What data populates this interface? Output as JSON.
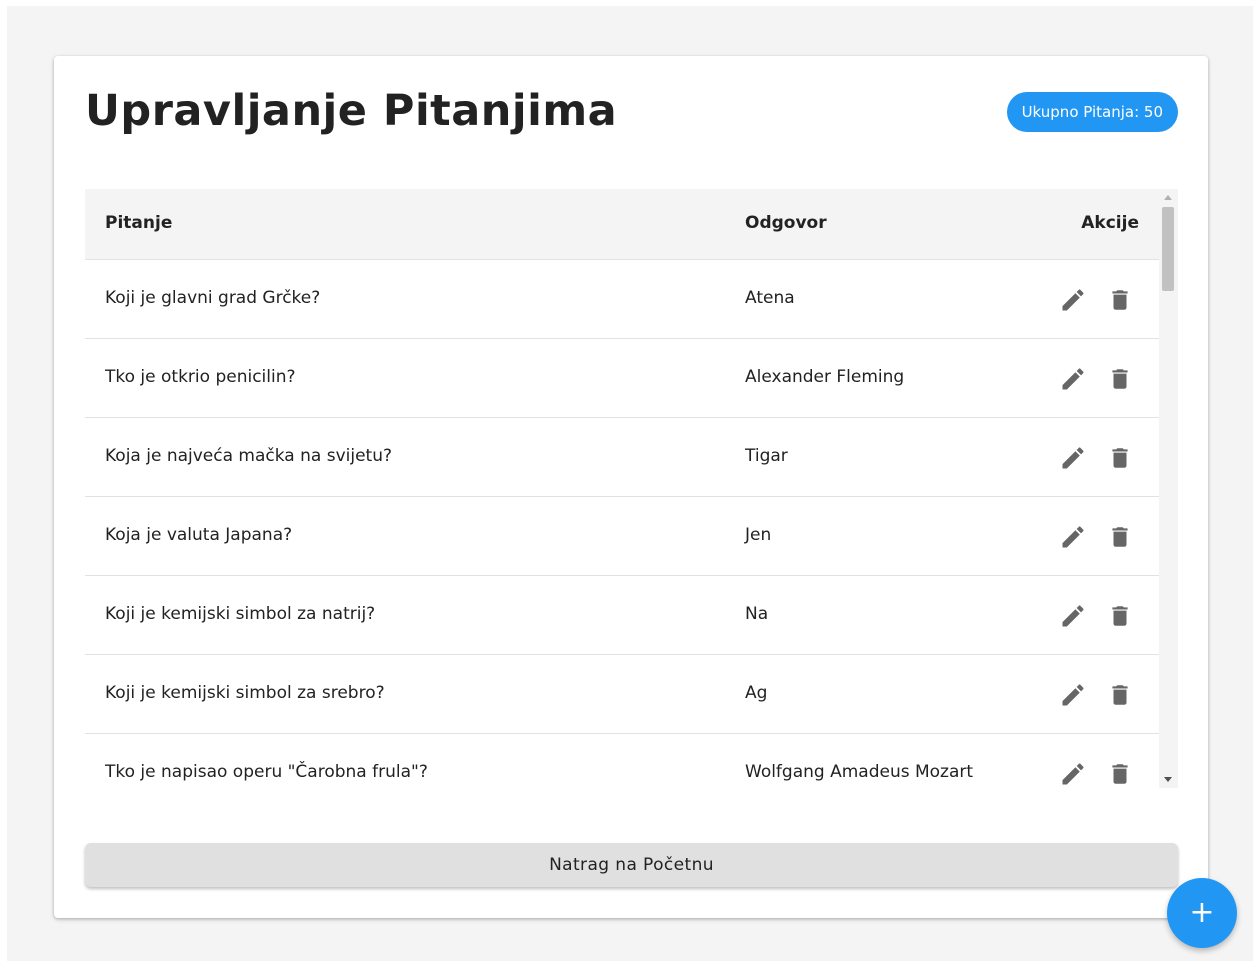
{
  "header": {
    "title": "Upravljanje Pitanjima",
    "badge": "Ukupno Pitanja: 50"
  },
  "table": {
    "columns": {
      "question": "Pitanje",
      "answer": "Odgovor",
      "actions": "Akcije"
    },
    "rows": [
      {
        "question": "Koji je glavni grad Grčke?",
        "answer": "Atena"
      },
      {
        "question": "Tko je otkrio penicilin?",
        "answer": "Alexander Fleming"
      },
      {
        "question": "Koja je najveća mačka na svijetu?",
        "answer": "Tigar"
      },
      {
        "question": "Koja je valuta Japana?",
        "answer": "Jen"
      },
      {
        "question": "Koji je kemijski simbol za natrij?",
        "answer": "Na"
      },
      {
        "question": "Koji je kemijski simbol za srebro?",
        "answer": "Ag"
      },
      {
        "question": "Tko je napisao operu \"Čarobna frula\"?",
        "answer": "Wolfgang Amadeus Mozart"
      }
    ]
  },
  "footer": {
    "back_label": "Natrag na Početnu"
  },
  "fab": {
    "label": "+"
  },
  "icons": {
    "edit": "pencil-icon",
    "delete": "trash-icon",
    "add": "plus-icon"
  },
  "colors": {
    "accent": "#2196f3",
    "icon": "#666666",
    "header_bg": "#f4f4f4"
  }
}
